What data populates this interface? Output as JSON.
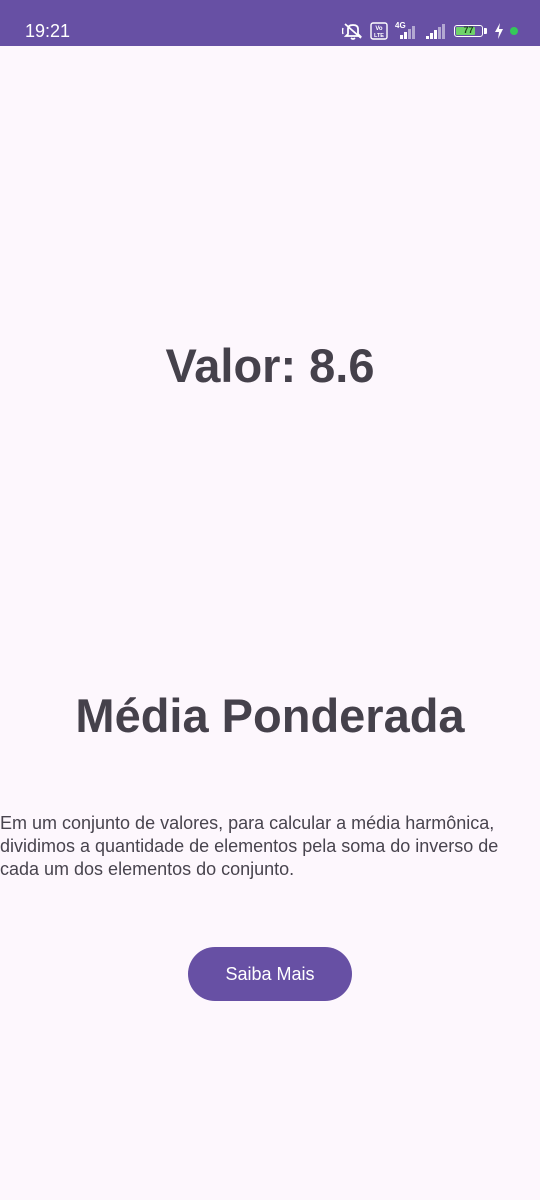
{
  "status_bar": {
    "time": "19:21",
    "network_label": "4G",
    "volte_label": "Vo LTE",
    "battery_percent": "77",
    "battery_level": 0.77,
    "background_color": "#6750a4",
    "icons": [
      "mute-icon",
      "volte-icon",
      "signal-icon",
      "signal-icon",
      "battery-icon",
      "charging-icon",
      "green-dot-icon"
    ]
  },
  "main": {
    "value_text": "Valor: 8.6",
    "title": "Média Ponderada",
    "description": "Em um conjunto de valores, para calcular a média harmônica, dividimos a quantidade de elementos pela soma do inverso de cada um dos elementos do conjunto.",
    "button_label": "Saiba Mais"
  },
  "colors": {
    "accent": "#6750a4",
    "background": "#fdf7fd",
    "text": "#45414b"
  }
}
